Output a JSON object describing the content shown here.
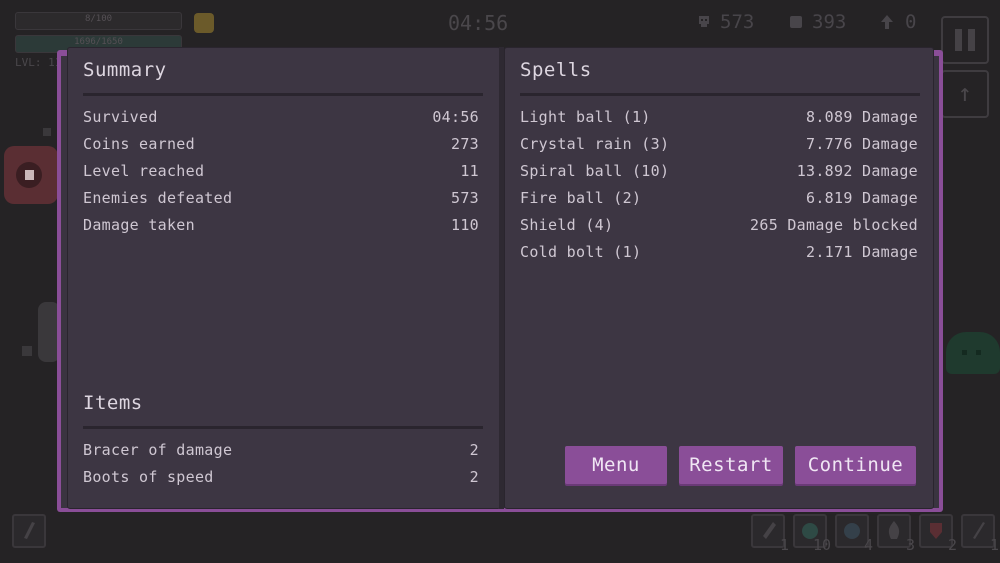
{
  "hud": {
    "health_text": "8/100",
    "xp_text": "1696/1650",
    "level_text": "LVL: 11",
    "timer": "04:56",
    "kills": "573",
    "coins": "393",
    "upgrades": "0",
    "slots": [
      {
        "icon": "dagger-icon",
        "count": "1"
      },
      {
        "icon": "orb-icon",
        "count": "10"
      },
      {
        "icon": "crystal-icon",
        "count": "4"
      },
      {
        "icon": "fire-icon",
        "count": "3"
      },
      {
        "icon": "shield-icon",
        "count": "2"
      },
      {
        "icon": "bolt-icon",
        "count": "1"
      }
    ]
  },
  "summary": {
    "title": "Summary",
    "rows": [
      {
        "label": "Survived",
        "value": "04:56"
      },
      {
        "label": "Coins earned",
        "value": "273"
      },
      {
        "label": "Level reached",
        "value": "11"
      },
      {
        "label": "Enemies defeated",
        "value": "573"
      },
      {
        "label": "Damage taken",
        "value": "110"
      }
    ]
  },
  "items": {
    "title": "Items",
    "rows": [
      {
        "label": "Bracer of damage",
        "value": "2"
      },
      {
        "label": "Boots of speed",
        "value": "2"
      }
    ]
  },
  "spells": {
    "title": "Spells",
    "rows": [
      {
        "label": "Light ball (1)",
        "value": "8.089 Damage"
      },
      {
        "label": "Crystal rain (3)",
        "value": "7.776 Damage"
      },
      {
        "label": "Spiral ball (10)",
        "value": "13.892 Damage"
      },
      {
        "label": "Fire ball (2)",
        "value": "6.819 Damage"
      },
      {
        "label": "Shield (4)",
        "value": "265 Damage blocked"
      },
      {
        "label": "Cold bolt (1)",
        "value": "2.171 Damage"
      }
    ]
  },
  "buttons": {
    "menu": "Menu",
    "restart": "Restart",
    "continue": "Continue"
  },
  "colors": {
    "accent": "#8a4e98",
    "page": "#3d3643",
    "background": "#252325"
  }
}
